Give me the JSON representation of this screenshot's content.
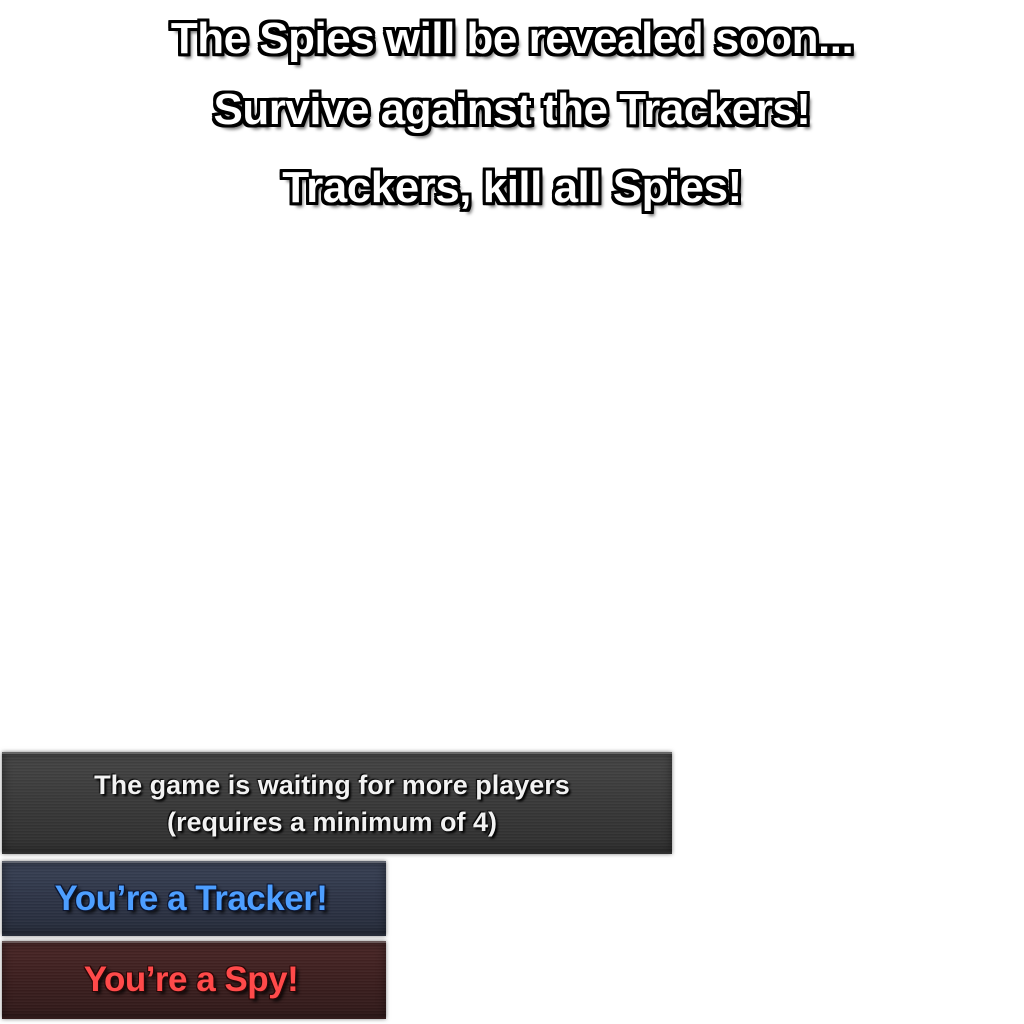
{
  "banners": {
    "line1": "The Spies will be revealed soon...",
    "line2": "Survive against the Trackers!",
    "line3": "Trackers, kill all Spies!"
  },
  "waiting_panel": {
    "line1": "The game is waiting for more players",
    "line2": "(requires a minimum of 4)"
  },
  "role_panels": {
    "tracker": "You’re a Tracker!",
    "spy": "You’re a Spy!"
  },
  "colors": {
    "tracker_text": "#4d9eff",
    "spy_text": "#ff4a4a",
    "waiting_panel_bg": "#393939",
    "tracker_panel_bg": "#2e3547",
    "spy_panel_bg": "#3c1f1f"
  }
}
